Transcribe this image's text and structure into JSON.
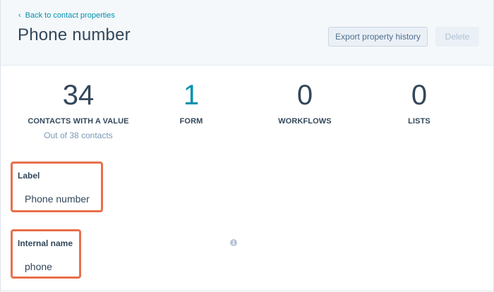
{
  "header": {
    "back_label": "Back to contact properties",
    "title": "Phone number",
    "export_label": "Export property history",
    "delete_label": "Delete"
  },
  "stats": [
    {
      "value": "34",
      "label": "CONTACTS WITH A VALUE",
      "sub": "Out of 38 contacts"
    },
    {
      "value": "1",
      "label": "FORM"
    },
    {
      "value": "0",
      "label": "WORKFLOWS"
    },
    {
      "value": "0",
      "label": "LISTS"
    }
  ],
  "fields": {
    "label": {
      "heading": "Label",
      "value": "Phone number"
    },
    "internal_name": {
      "heading": "Internal name",
      "value": "phone"
    }
  },
  "icons": {
    "back": "chevron-left-icon",
    "info": "info-icon"
  },
  "colors": {
    "accent": "#0091ae",
    "highlight": "#e8704b",
    "text": "#33475b",
    "muted": "#7c98b6"
  }
}
